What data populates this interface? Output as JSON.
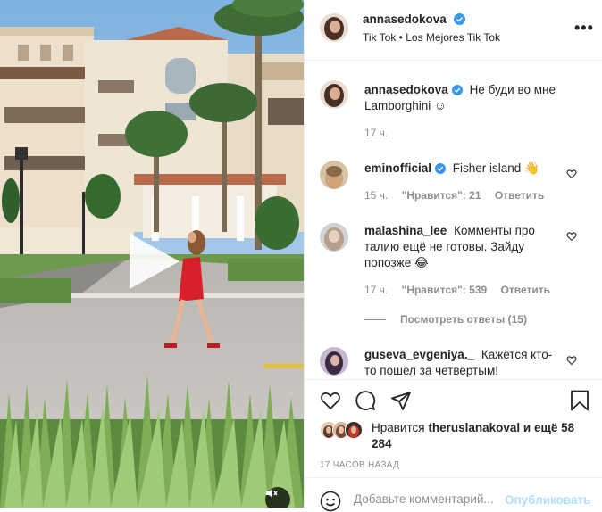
{
  "post": {
    "author": {
      "username": "annasedokova",
      "verified": true,
      "subtitle": "Tik Tok • Los Mejores Tik Tok"
    },
    "media": {
      "type": "video",
      "muted": true,
      "play_icon": "play-icon",
      "mute_icon": "speaker-muted-icon"
    },
    "more_icon": "more-horizontal-icon",
    "more_label": "•••",
    "caption": {
      "username": "annasedokova",
      "verified": true,
      "text": "Не буди во мне Lamborghini ☺",
      "time": "17 ч."
    },
    "comments": [
      {
        "username": "eminofficial",
        "verified": true,
        "text": "Fisher island 👋",
        "time": "15 ч.",
        "likes": "\"Нравится\": 21",
        "reply": "Ответить"
      },
      {
        "username": "malashina_lee",
        "verified": false,
        "text": "Комменты про талию ещё не готовы. Зайду попозже 😂",
        "time": "17 ч.",
        "likes": "\"Нравится\": 539",
        "reply": "Ответить",
        "view_replies": "Посмотреть ответы (15)"
      },
      {
        "username": "guseva_evgeniya._",
        "verified": false,
        "text": "Кажется кто-то пошел за четвертым!"
      }
    ],
    "actions": {
      "like_icon": "heart-icon",
      "comment_icon": "comment-icon",
      "share_icon": "paper-plane-icon",
      "save_icon": "bookmark-icon"
    },
    "likes": {
      "prefix": "Нравится",
      "user": "theruslanakoval",
      "suffix": "и ещё 58 284"
    },
    "timestamp": "17 ЧАСОВ НАЗАД",
    "add_comment": {
      "emoji_icon": "smiley-icon",
      "placeholder": "Добавьте комментарий...",
      "publish_label": "Опубликовать"
    },
    "colors": {
      "verified_blue": "#3897f0",
      "text": "#262626",
      "secondary": "#8e8e8e",
      "publish_disabled": "#b2dffc",
      "divider": "#efefef"
    }
  }
}
